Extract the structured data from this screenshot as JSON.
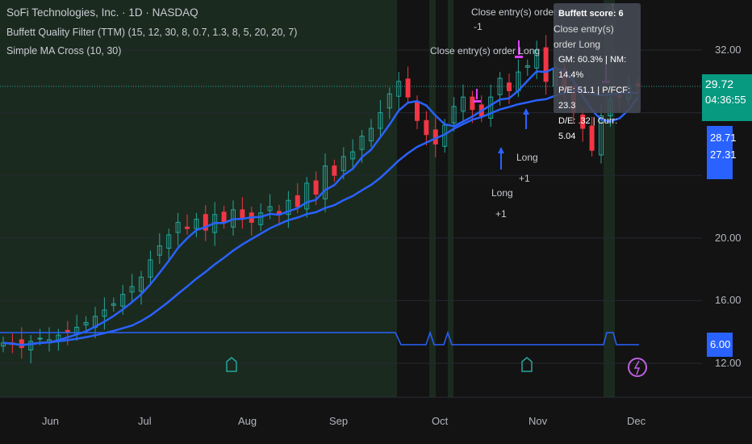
{
  "header": {
    "symbol_line": "SoFi Technologies, Inc. · 1D · NASDAQ",
    "indicator_1": "Buffett Quality Filter (TTM) (15, 12, 30, 8, 0.7, 1.3, 8, 5, 20, 20, 7)",
    "indicator_2": "Simple MA Cross (10, 30)"
  },
  "price_axis": [
    "32.00",
    "20.00",
    "16.00",
    "12.00"
  ],
  "tags": {
    "last_price": "29.72",
    "countdown": "04:36:55",
    "ma_fast": "28.71",
    "ma_slow": "27.31",
    "score": "6.00"
  },
  "time_axis": [
    "Jun",
    "Jul",
    "Aug",
    "Sep",
    "Oct",
    "Nov",
    "Dec"
  ],
  "tooltip": {
    "score": "Buffett score: 6",
    "overlay": "Close entry(s) order Long",
    "gm_nm": "GM: 60.3% | NM: 14.4%",
    "pe_pfcf": "P/E: 51.1 | P/FCF: 23.3",
    "de_curr": "D/E: .32 | Curr: 5.04"
  },
  "annotations": {
    "close1": "Close entry(s) order Long",
    "close1_qty": "-1",
    "close2": "Close entry(s) order Long",
    "long1": "Long",
    "long1_qty": "+1",
    "long2": "Long",
    "long2_qty": "+1",
    "top_qty": "-1"
  },
  "earnings_marker": "E",
  "colors": {
    "up": "#26a69a",
    "down": "#f23645",
    "ma": "#2962ff",
    "signal": "#e040fb",
    "bg_green": "#1b2a1f"
  },
  "chart_data": {
    "type": "candlestick",
    "ylim": [
      11,
      34
    ],
    "closes": [
      13.3,
      13.2,
      13.0,
      13.4,
      13.6,
      13.5,
      13.8,
      14.0,
      14.3,
      14.6,
      15.0,
      15.4,
      15.8,
      16.4,
      16.9,
      17.5,
      18.6,
      19.5,
      20.2,
      21.0,
      20.6,
      21.2,
      20.5,
      21.5,
      21.0,
      21.8,
      21.3,
      21.0,
      21.6,
      22.0,
      21.5,
      22.4,
      22.0,
      23.5,
      22.8,
      24.6,
      24.0,
      25.2,
      25.5,
      26.5,
      27.0,
      28.0,
      29.2,
      30.0,
      29.0,
      27.5,
      26.6,
      26.0,
      27.2,
      28.4,
      29.0,
      28.2,
      27.8,
      29.0,
      30.2,
      29.4,
      30.6,
      31.0,
      32.0,
      30.0,
      30.8,
      29.4,
      28.0,
      27.0,
      25.6,
      27.8,
      28.8,
      29.0,
      29.7,
      29.72
    ]
  }
}
